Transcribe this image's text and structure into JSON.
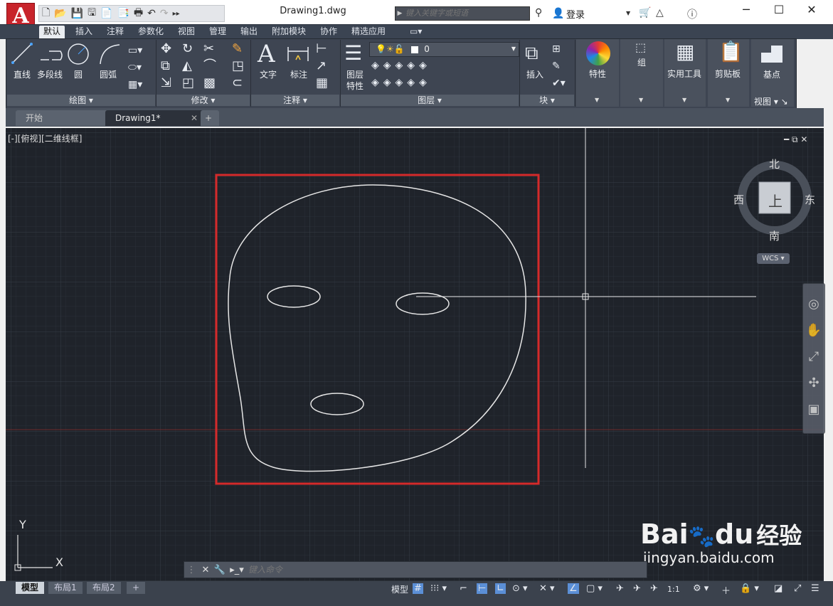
{
  "app": {
    "logo_letter": "A",
    "doc_title": "Drawing1.dwg",
    "search_placeholder": "键入关键字或短语",
    "login": "登录"
  },
  "ribbon_tabs": [
    "默认",
    "插入",
    "注释",
    "参数化",
    "视图",
    "管理",
    "输出",
    "附加模块",
    "协作",
    "精选应用"
  ],
  "ribbon": {
    "draw": {
      "line": "直线",
      "polyline": "多段线",
      "circle": "圆",
      "arc": "圆弧",
      "title": "绘图"
    },
    "modify": {
      "title": "修改"
    },
    "annotation": {
      "text": "文字",
      "dimension": "标注",
      "title": "注释"
    },
    "layers": {
      "properties_line1": "图层",
      "properties_line2": "特性",
      "current_layer": "0",
      "title": "图层"
    },
    "block": {
      "insert": "插入",
      "title": "块"
    },
    "properties": {
      "label": "特性"
    },
    "groups": {
      "label": "组"
    },
    "utilities": {
      "label": "实用工具"
    },
    "clipboard": {
      "label": "剪贴板"
    },
    "view": {
      "base": "基点",
      "title": "视图"
    }
  },
  "doc_tabs": {
    "start": "开始",
    "active": "Drawing1*"
  },
  "viewport": {
    "label": "[-][俯视][二维线框]",
    "viewcube": {
      "north": "北",
      "south": "南",
      "east": "东",
      "west": "西",
      "face": "上",
      "wcs": "WCS"
    },
    "ucs": {
      "x": "X",
      "y": "Y"
    }
  },
  "command": {
    "placeholder": "键入命令"
  },
  "layout_tabs": [
    "模型",
    "布局1",
    "布局2"
  ],
  "status": {
    "model": "模型",
    "scale": "1:1"
  },
  "watermark": {
    "brand": "Bai",
    "brand2": "du",
    "cn": "经验",
    "url": "jingyan.baidu.com"
  },
  "colors": {
    "accent_red": "#d42a2a",
    "canvas_bg": "#1f232a",
    "ribbon_bg": "#3e4552"
  }
}
